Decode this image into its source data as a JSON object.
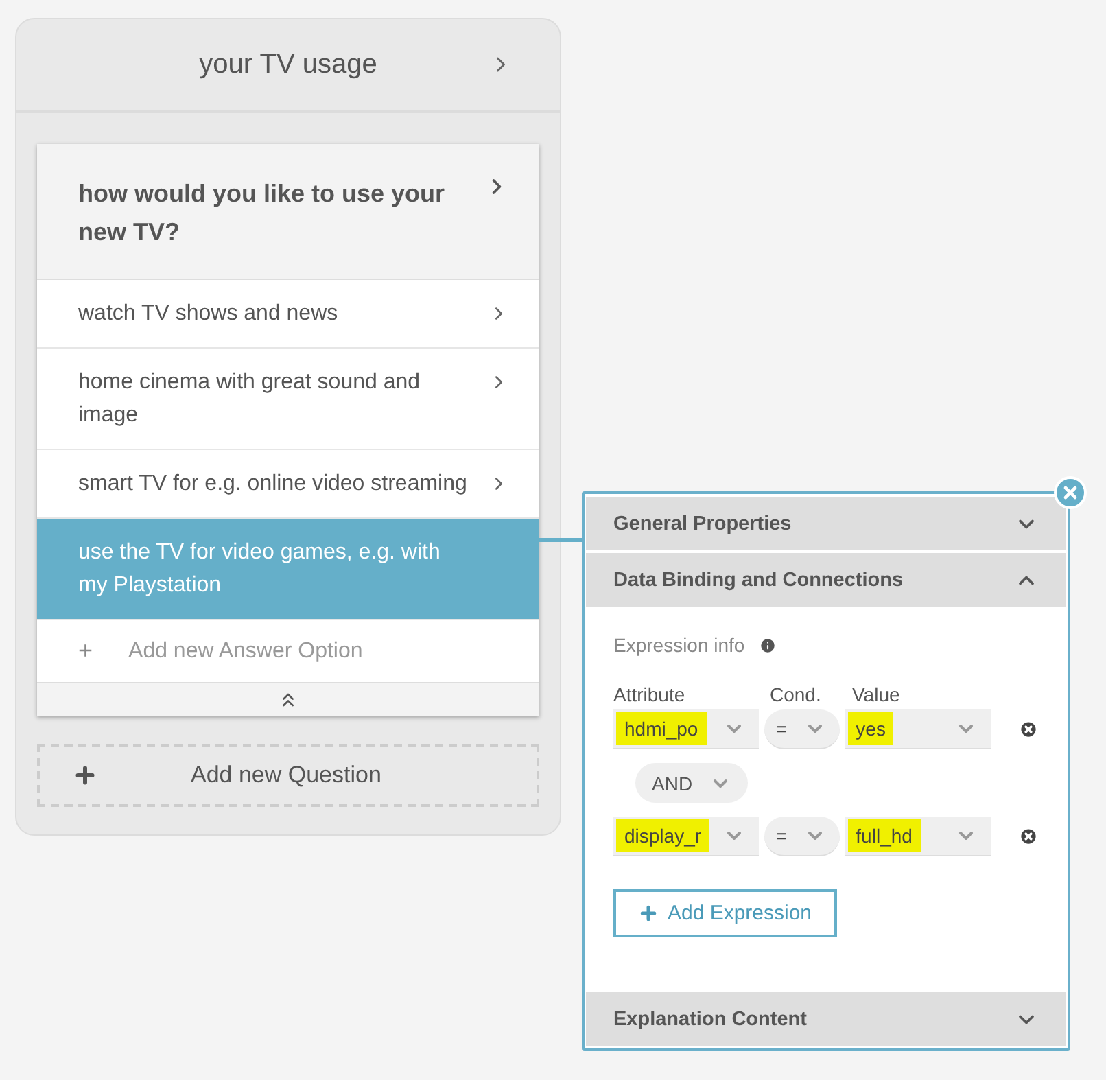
{
  "section": {
    "title": "your TV usage"
  },
  "question": {
    "title": "how would you like to use your new TV?"
  },
  "answers": [
    {
      "label": "watch TV shows and news",
      "selected": false
    },
    {
      "label": "home cinema with great sound and image",
      "selected": false
    },
    {
      "label": "smart TV for e.g. online video streaming",
      "selected": false
    },
    {
      "label": "use the TV for video games, e.g. with my Playstation",
      "selected": true
    }
  ],
  "add_answer": {
    "icon": "+",
    "label": "Add new Answer Option"
  },
  "add_question": {
    "label": "Add new Question"
  },
  "panel": {
    "sections": [
      {
        "title": "General Properties",
        "expanded": false
      },
      {
        "title": "Data Binding and Connections",
        "expanded": true
      },
      {
        "title": "Explanation Content",
        "expanded": false
      }
    ],
    "expression_info": "Expression info",
    "columns": [
      "Attribute",
      "Cond.",
      "Value"
    ],
    "expressions": [
      {
        "attribute": {
          "value": "hdmi_po",
          "highlighted": true
        },
        "cond": {
          "value": "=",
          "highlighted": false
        },
        "value": {
          "value": "yes",
          "highlighted": true
        }
      },
      {
        "connector": "AND",
        "attribute": {
          "value": "display_r",
          "highlighted": true
        },
        "cond": {
          "value": "=",
          "highlighted": false
        },
        "value": {
          "value": "full_hd",
          "highlighted": true
        }
      }
    ],
    "add_expression": "Add Expression"
  }
}
